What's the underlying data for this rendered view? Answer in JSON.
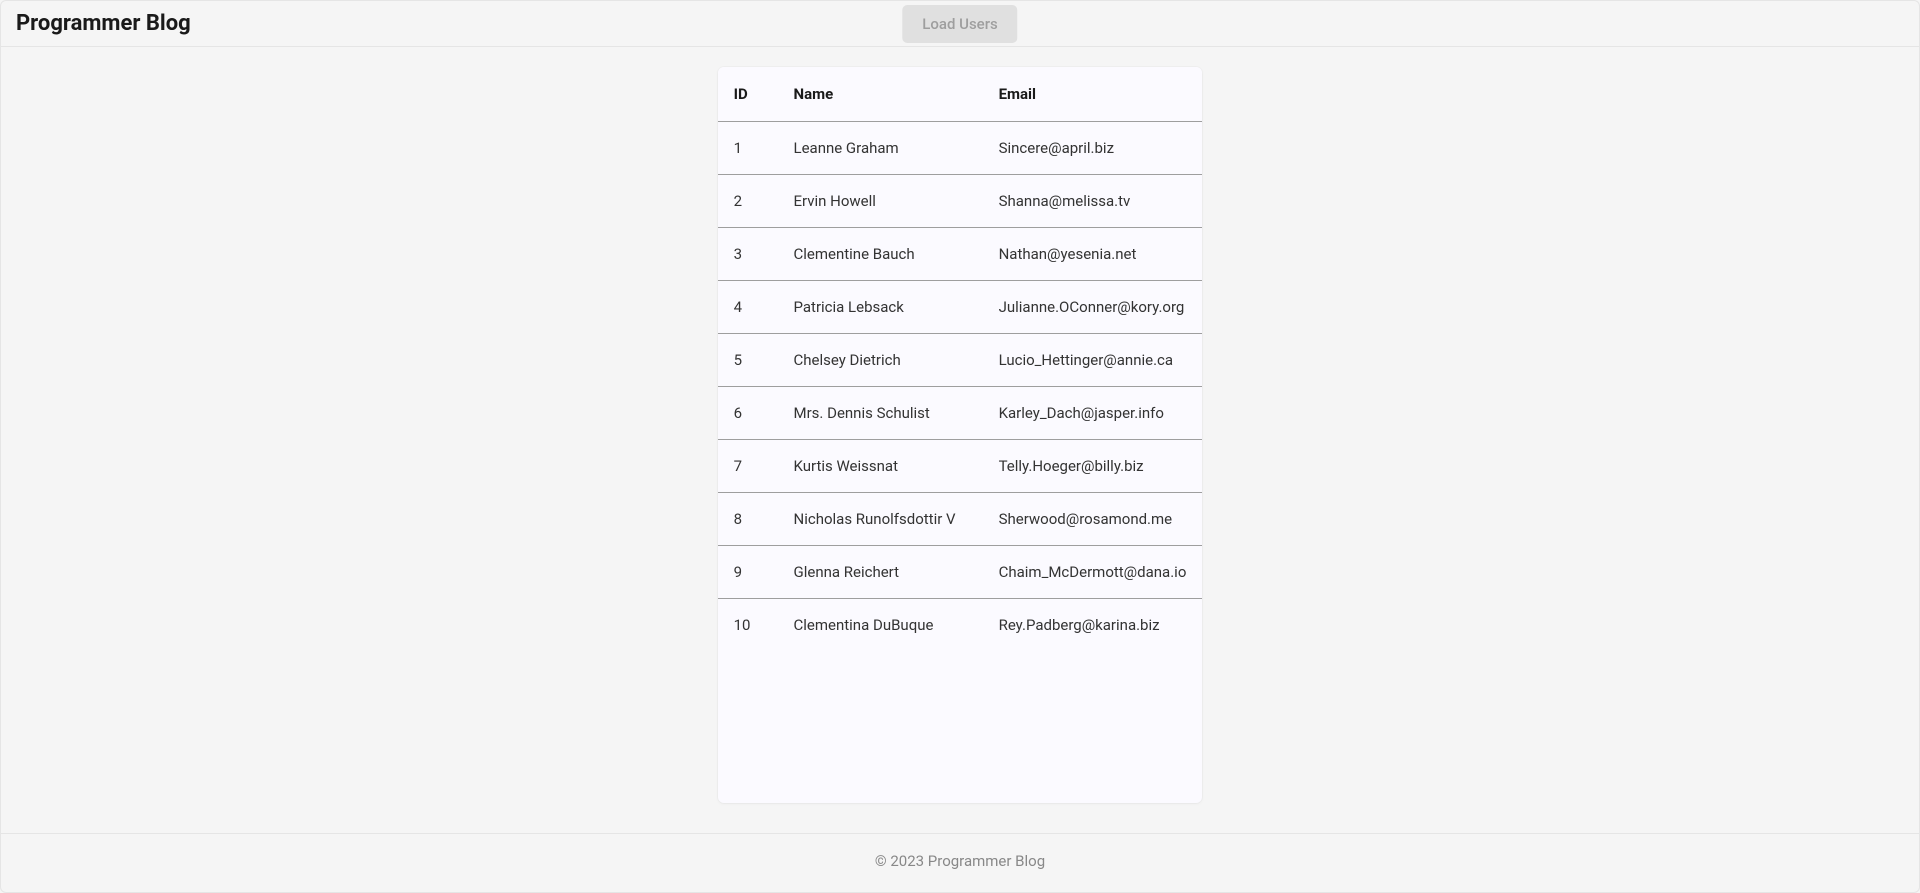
{
  "header": {
    "title": "Programmer Blog",
    "load_button_label": "Load Users"
  },
  "table": {
    "columns": {
      "id": "ID",
      "name": "Name",
      "email": "Email"
    },
    "rows": [
      {
        "id": "1",
        "name": "Leanne Graham",
        "email": "Sincere@april.biz"
      },
      {
        "id": "2",
        "name": "Ervin Howell",
        "email": "Shanna@melissa.tv"
      },
      {
        "id": "3",
        "name": "Clementine Bauch",
        "email": "Nathan@yesenia.net"
      },
      {
        "id": "4",
        "name": "Patricia Lebsack",
        "email": "Julianne.OConner@kory.org"
      },
      {
        "id": "5",
        "name": "Chelsey Dietrich",
        "email": "Lucio_Hettinger@annie.ca"
      },
      {
        "id": "6",
        "name": "Mrs. Dennis Schulist",
        "email": "Karley_Dach@jasper.info"
      },
      {
        "id": "7",
        "name": "Kurtis Weissnat",
        "email": "Telly.Hoeger@billy.biz"
      },
      {
        "id": "8",
        "name": "Nicholas Runolfsdottir V",
        "email": "Sherwood@rosamond.me"
      },
      {
        "id": "9",
        "name": "Glenna Reichert",
        "email": "Chaim_McDermott@dana.io"
      },
      {
        "id": "10",
        "name": "Clementina DuBuque",
        "email": "Rey.Padberg@karina.biz"
      }
    ]
  },
  "footer": {
    "text": "© 2023 Programmer Blog"
  }
}
